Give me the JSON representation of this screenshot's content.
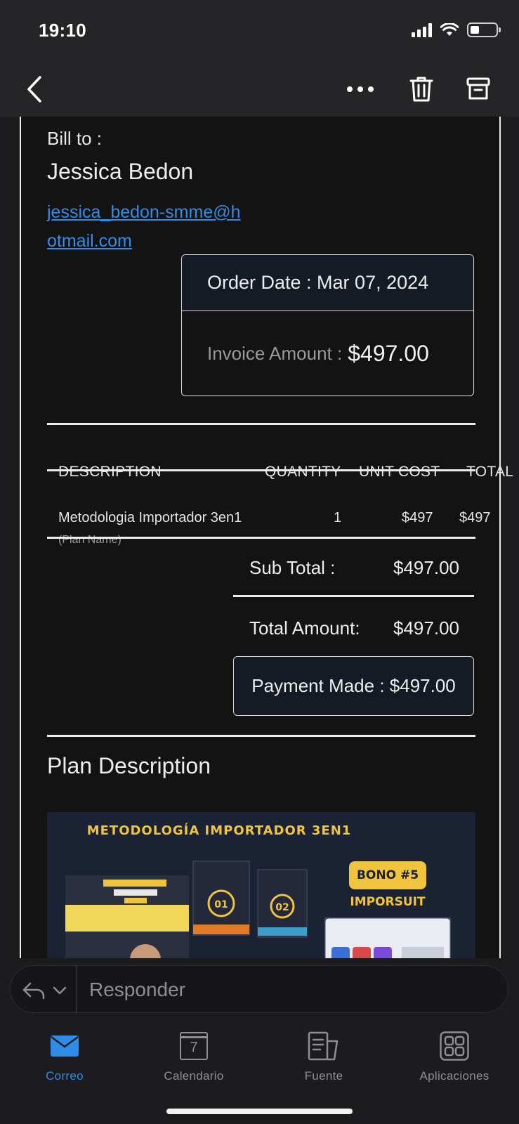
{
  "status_bar": {
    "time": "19:10"
  },
  "nav": {
    "back_icon": "chevron-left-icon",
    "more_icon": "more-icon",
    "delete_icon": "trash-icon",
    "archive_icon": "archive-icon"
  },
  "email": {
    "bill_to_label": "Bill to :",
    "customer_name": "Jessica Bedon",
    "customer_email": "jessica_bedon-smme@hotmail.com",
    "order_date": "Order Date : Mar 07, 2024",
    "invoice_amount_label": "Invoice Amount :",
    "invoice_amount_value": "$497.00",
    "table": {
      "headers": [
        "DESCRIPTION",
        "QUANTITY",
        "UNIT COST",
        "TOTAL"
      ],
      "rows": [
        {
          "description": "Metodologia Importador 3en1",
          "sub": "(Plan Name)",
          "quantity": "1",
          "unit_cost": "$497",
          "total": "$497"
        }
      ]
    },
    "sub_total_label": "Sub Total :",
    "sub_total_value": "$497.00",
    "total_amount_label": "Total Amount:",
    "total_amount_value": "$497.00",
    "payment_made": "Payment Made : $497.00",
    "plan_description_title": "Plan Description",
    "banner": {
      "title": "METODOLOGÍA IMPORTADOR 3EN1",
      "bono": "BONO #5",
      "bono_sub": "IMPORSUIT",
      "box_numbers": [
        "01",
        "02"
      ]
    }
  },
  "reply": {
    "placeholder": "Responder"
  },
  "tabs": [
    {
      "label": "Correo",
      "icon": "mail-icon",
      "active": true
    },
    {
      "label": "Calendario",
      "icon": "calendar-icon",
      "day": "7"
    },
    {
      "label": "Fuente",
      "icon": "feed-icon"
    },
    {
      "label": "Aplicaciones",
      "icon": "apps-icon"
    }
  ],
  "colors": {
    "accent": "#2f8ce8",
    "banner_bg": "#1b2233",
    "banner_gold": "#f0c43c"
  }
}
